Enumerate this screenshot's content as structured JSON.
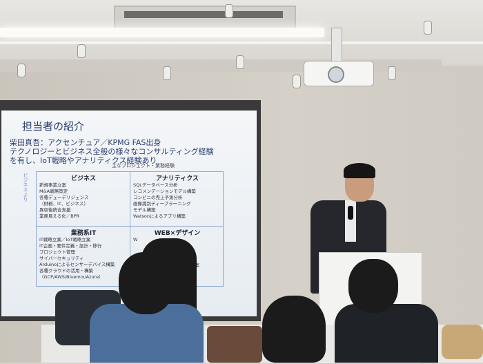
{
  "slide": {
    "title": "担当者の紹介",
    "lines": [
      "柴田真吾：アクセンチュア／KPMG FAS出身",
      "テクノロジーとビジネス全般の様々なコンサルティング経験",
      "を有し、IoT戦略やアナリティクス経験あり"
    ],
    "projects_label": "主なプロジェクト・業務経験",
    "axis_label": "ビジネスより",
    "quadrants": [
      {
        "title": "ビジネス",
        "items": [
          "新規事業立案",
          "M&A戦略策定",
          "各種デューデリジェンス",
          "（財務、IT、ビジネス）",
          "異収後統合支援",
          "業務見える化／BPR"
        ]
      },
      {
        "title": "アナリティクス",
        "items": [
          "SQLデータベース分析",
          "レコメンデーションモデル構築",
          "コンビニの売上予測分析",
          "画像識別ディープラーニング",
          "モデル構築",
          "Watsonによるアプリ構築"
        ]
      },
      {
        "title": "業務系IT",
        "items": [
          "IT戦略立案／IoT戦略立案",
          "IT企画・要件定義・設計・移行",
          "プロジェクト管理",
          "サイバーセキュリティ",
          "Arduinoによるセンサーデバイス構築",
          "各種クラウドの活用・構築",
          "（GCP/AWS/Bluemix/Azure）"
        ]
      },
      {
        "title": "WEB×デザイン",
        "items": [
          "W",
          "ション",
          "ィング",
          "事業立案"
        ]
      }
    ]
  },
  "colors": {
    "slide_text": "#283c6e",
    "grid_line": "#8ea8d0"
  }
}
